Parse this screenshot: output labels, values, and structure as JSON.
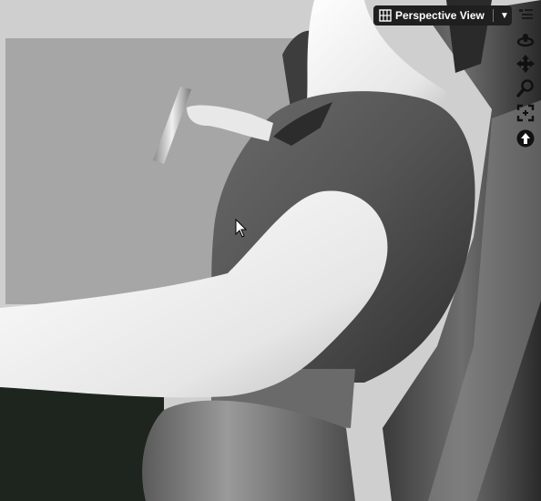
{
  "viewport": {
    "camera_label": "Perspective View",
    "dropdown_glyph": "▼",
    "tools": [
      {
        "name": "viewport-options-icon"
      },
      {
        "name": "orbit-icon"
      },
      {
        "name": "pan-icon"
      },
      {
        "name": "zoom-icon"
      },
      {
        "name": "frame-icon"
      },
      {
        "name": "reset-view-icon"
      }
    ]
  },
  "colors": {
    "viewport_bg": "#c9c9c9",
    "backdrop_panel": "#a6a6a6",
    "figure_light": "#f2f2f2",
    "figure_dark": "#4a4a4a",
    "toolbar_bg": "#1f1f1f"
  }
}
